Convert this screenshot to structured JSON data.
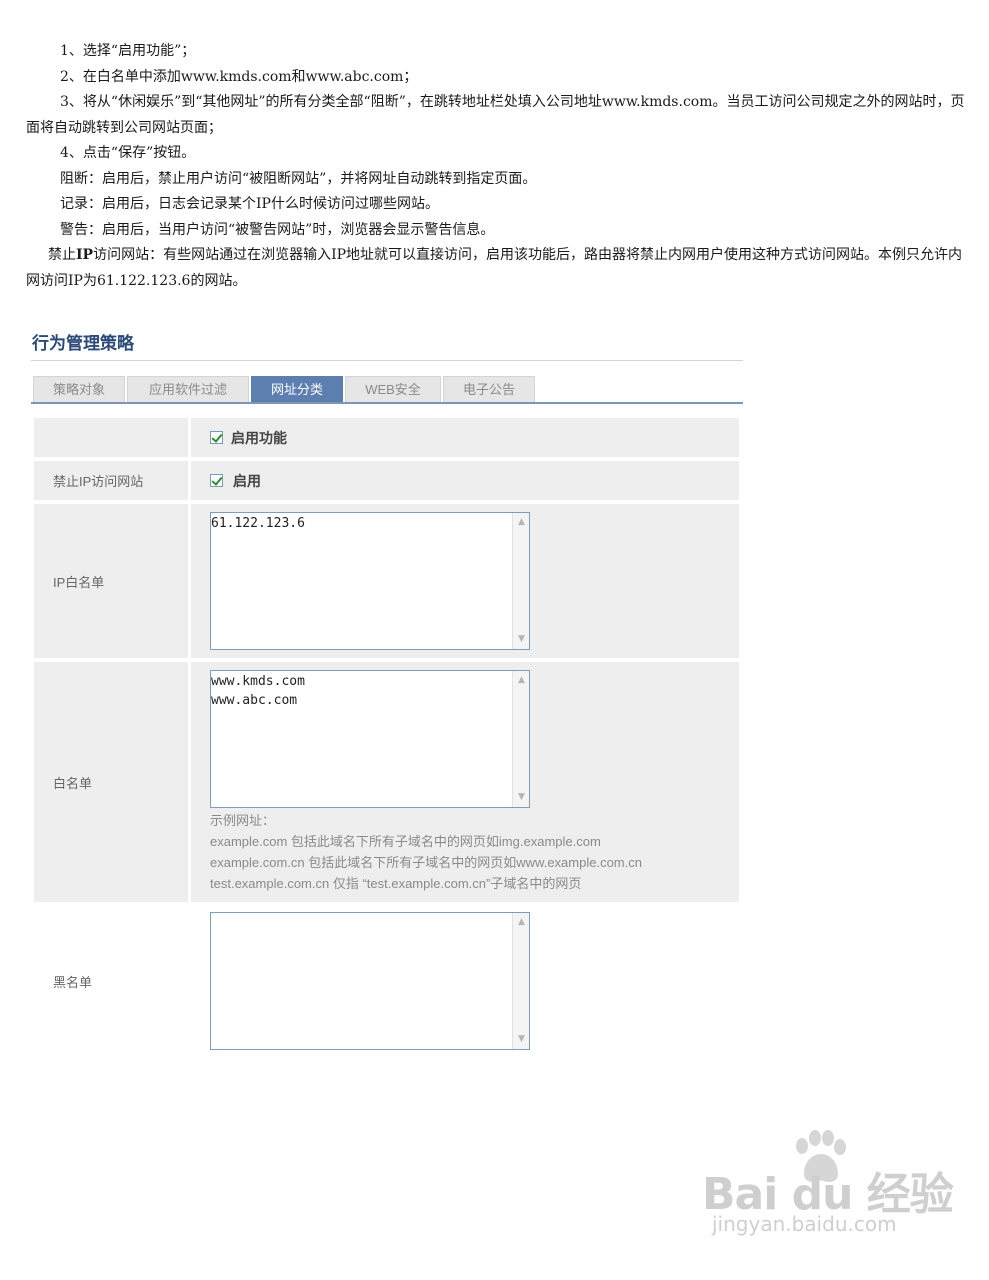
{
  "instructions": {
    "step1": "1、选择“启用功能”；",
    "step2": "2、在白名单中添加www.kmds.com和www.abc.com；",
    "step3": "3、将从“休闲娱乐”到“其他网址”的所有分类全部“阻断”，在跳转地址栏处填入公司地址www.kmds.com。当员工访问公司规定之外的网站时，页面将自动跳转到公司网站页面；",
    "step4": "4、点击“保存”按钮。",
    "block": "阻断：启用后，禁止用户访问“被阻断网站”，并将网址自动跳转到指定页面。",
    "record": "记录：启用后，日志会记录某个IP什么时候访问过哪些网站。",
    "warn": "警告：启用后，当用户访问“被警告网站”时，浏览器会显示警告信息。",
    "ip_prefix": "禁止",
    "ip_bold": "IP",
    "ip_text": "访问网站：有些网站通过在浏览器输入IP地址就可以直接访问，启用该功能后，路由器将禁止内网用户使用这种方式访问网站。本例只允许内网访问IP为61.122.123.6的网站。"
  },
  "panel": {
    "title": "行为管理策略",
    "tabs": [
      {
        "label": "策略对象",
        "active": false
      },
      {
        "label": "应用软件过滤",
        "active": false
      },
      {
        "label": "网址分类",
        "active": true
      },
      {
        "label": "WEB安全",
        "active": false
      },
      {
        "label": "电子公告",
        "active": false
      }
    ],
    "enable_feature": {
      "label": "启用功能",
      "checked": true
    },
    "ban_ip": {
      "label": "禁止IP访问网站",
      "checkbox_label": "启用",
      "checked": true
    },
    "ip_whitelist": {
      "label": "IP白名单",
      "value": "61.122.123.6"
    },
    "whitelist": {
      "label": "白名单",
      "value": "www.kmds.com\nwww.abc.com",
      "hint_title": "示例网址：",
      "hint1": "example.com 包括此域名下所有子域名中的网页如img.example.com",
      "hint2": "example.com.cn 包括此域名下所有子域名中的网页如www.example.com.cn",
      "hint3": "test.example.com.cn 仅指 “test.example.com.cn”子域名中的网页"
    },
    "blacklist": {
      "label": "黑名单",
      "value": ""
    }
  },
  "watermark": {
    "logo": "Bai du 经验",
    "url": "jingyan.baidu.com"
  },
  "colors": {
    "tab_active": "#5d7fb0",
    "title": "#2c4a78",
    "row_bg": "#eeeeee",
    "check": "#2e8b2e"
  }
}
